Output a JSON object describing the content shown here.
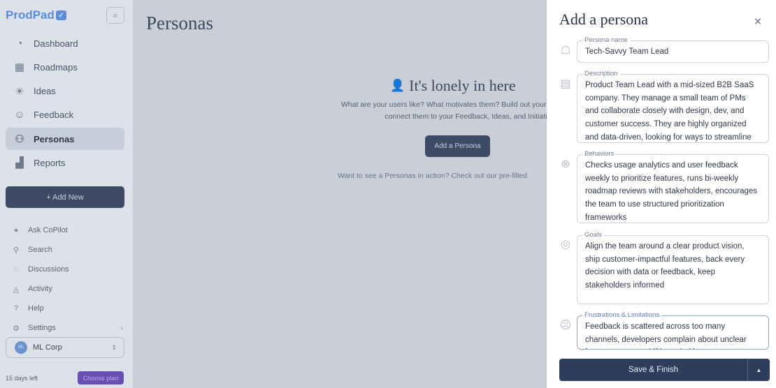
{
  "sidebar": {
    "logo": "ProdPad",
    "logo_badge": "✓",
    "collapse": "«",
    "items": [
      {
        "label": "Dashboard",
        "icon": "◔"
      },
      {
        "label": "Roadmaps",
        "icon": "▦"
      },
      {
        "label": "Ideas",
        "icon": "☀"
      },
      {
        "label": "Feedback",
        "icon": "☺"
      },
      {
        "label": "Personas",
        "icon": "⚇"
      },
      {
        "label": "Reports",
        "icon": "▟"
      }
    ],
    "add_new": "+ Add New",
    "secondary": [
      {
        "label": "Ask CoPilot",
        "icon": "✦"
      },
      {
        "label": "Search",
        "icon": "⚲"
      },
      {
        "label": "Discussions",
        "icon": "◌"
      },
      {
        "label": "Activity",
        "icon": "◬"
      },
      {
        "label": "Help",
        "icon": "?"
      },
      {
        "label": "Settings",
        "icon": "⚙",
        "chevron": "›"
      }
    ],
    "workspace": {
      "avatar": "ML",
      "name": "ML Corp",
      "chevron": "⇕"
    },
    "trial": "15 days left",
    "choose_plan": "Choose plan"
  },
  "main": {
    "title": "Personas",
    "empty_icon": "👤",
    "empty_title": "It's lonely in here",
    "empty_desc_1": "What are your users like? What motivates them? Build out your pe",
    "empty_desc_2": "connect them to your Feedback, Ideas, and Initiative",
    "add_button": "Add a Persona",
    "hint": "Want to see a Personas in action? Check out our pre-filled"
  },
  "panel": {
    "title": "Add a persona",
    "close": "×",
    "fields": [
      {
        "label": "Persona name",
        "icon": "☖",
        "value": "Tech-Savvy Team Lead"
      },
      {
        "label": "Description",
        "icon": "▤",
        "value": "Product Team Lead with a mid-sized B2B SaaS company. They manage a small team of PMs and collaborate closely with design, dev, and customer success. They are highly organized and data-driven, looking for ways to streamline"
      },
      {
        "label": "Behaviors",
        "icon": "⊗",
        "value": "Checks usage analytics and user feedback weekly to prioritize features, runs bi-weekly roadmap reviews with stakeholders, encourages the team to use structured prioritization frameworks"
      },
      {
        "label": "Goals",
        "icon": "◎",
        "value": "Align the team around a clear product vision, ship customer-impactful features, back every decision with data or feedback, keep stakeholders informed"
      },
      {
        "label": "Frustrations & Limitations",
        "icon": "☹",
        "value": "Feedback is scattered across too many channels, developers complain about unclear feature specs or shifting priorities"
      }
    ],
    "save_label": "Save & Finish",
    "save_arrow": "▲"
  }
}
